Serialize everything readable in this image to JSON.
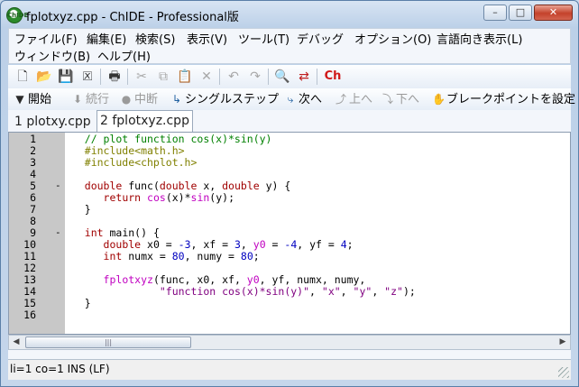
{
  "window": {
    "title": "fplotxyz.cpp - ChIDE - Professional版",
    "app_icon_label": "ChIDE",
    "controls": {
      "minimize": "–",
      "maximize": "□",
      "close": "✕"
    }
  },
  "menu": [
    "ファイル(F)",
    "編集(E)",
    "検索(S)",
    "表示(V)",
    "ツール(T)",
    "デバッグ",
    "オプション(O)",
    "言語向き表示(L)",
    "ウィンドウ(B)",
    "ヘルプ(H)"
  ],
  "toolbar": {
    "icons": [
      "new-file-icon",
      "open-folder-icon",
      "save-icon",
      "close-file-icon",
      "print-icon",
      "cut-icon",
      "copy-icon",
      "paste-icon",
      "delete-icon",
      "undo-icon",
      "redo-icon",
      "find-icon",
      "replace-icon",
      "ch-icon"
    ],
    "ch_label": "Ch"
  },
  "debug_toolbar": {
    "start": "開始",
    "continue": "続行",
    "abort": "中断",
    "single_step": "シングルステップ",
    "next": "次へ",
    "up": "上へ",
    "down": "下へ",
    "breakpoint": "ブレークポイントを設定"
  },
  "tabs": [
    {
      "label": "1 plotxy.cpp",
      "active": false
    },
    {
      "label": "2 fplotxyz.cpp",
      "active": true
    }
  ],
  "editor": {
    "line_numbers": [
      "1",
      "2",
      "3",
      "4",
      "5",
      "6",
      "7",
      "8",
      "9",
      "10",
      "11",
      "12",
      "13",
      "14",
      "15",
      "16"
    ],
    "lines": [
      "   // plot function cos(x)*sin(y)",
      "   #include<math.h>",
      "   #include<chplot.h>",
      "",
      "   double func(double x, double y) {",
      "      return cos(x)*sin(y);",
      "   }",
      "",
      "   int main() {",
      "      double x0 = -3, xf = 3, y0 = -4, yf = 4;",
      "      int numx = 80, numy = 80;",
      "",
      "      fplotxyz(func, x0, xf, y0, yf, numx, numy,",
      "               \"function cos(x)*sin(y)\", \"x\", \"y\", \"z\");",
      "   }",
      ""
    ],
    "fold_markers": [
      "",
      "",
      "",
      "",
      "-",
      "",
      "",
      "",
      "-",
      "",
      "",
      "",
      "",
      "",
      "",
      ""
    ]
  },
  "scrollbar": {
    "left_arrow": "◀",
    "right_arrow": "▶",
    "grip": "|||"
  },
  "status": {
    "text": "li=1 co=1 INS (LF)"
  },
  "colors": {
    "keyword": "#a00000",
    "comment": "#008000",
    "preprocessor": "#808000",
    "function": "#c000c0",
    "number": "#0000c0",
    "string": "#800080"
  }
}
